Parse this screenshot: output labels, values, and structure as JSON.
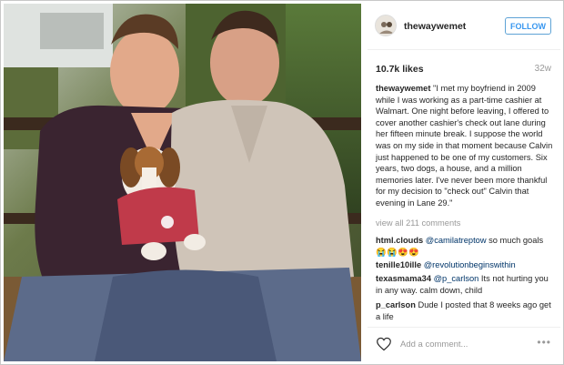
{
  "post": {
    "username": "thewaywemet",
    "follow_label": "FOLLOW",
    "likes": "10.7k likes",
    "time_ago": "32w",
    "caption_user": "thewaywemet",
    "caption_text": " \"I met my boyfriend in 2009 while I was working as a part-time cashier at Walmart. One night before leaving, I offered to cover another cashier's check out lane during her fifteen minute break. I suppose the world was on my side in that moment because Calvin just happened to be one of my customers. Six years, two dogs, a house, and a million memories later. I've never been more thankful for my decision to \"check out\" Calvin that evening in Lane 29.\"",
    "view_all": "view all 211 comments"
  },
  "comments": [
    {
      "user": "html.clouds",
      "mention": "@camilatreptow",
      "text": " so much goals",
      "emojis": "😭😭😍😍"
    },
    {
      "user": "tenille10ille",
      "mention": "@revolutionbeginswithin",
      "text": "",
      "emojis": ""
    },
    {
      "user": "texasmama34",
      "mention": "@p_carlson",
      "text": " Its not hurting you in any way. calm down, child",
      "emojis": ""
    },
    {
      "user": "p_carlson",
      "mention": "",
      "text": " Dude I posted that 8 weeks ago get a life",
      "emojis": ""
    }
  ],
  "footer": {
    "add_comment_placeholder": "Add a comment...",
    "more_label": "•••"
  },
  "icons": {
    "heart": "heart-icon",
    "avatar": "avatar",
    "more": "more-options-icon"
  },
  "colors": {
    "follow_blue": "#3897f0",
    "mention": "#003569",
    "muted": "#999999"
  }
}
